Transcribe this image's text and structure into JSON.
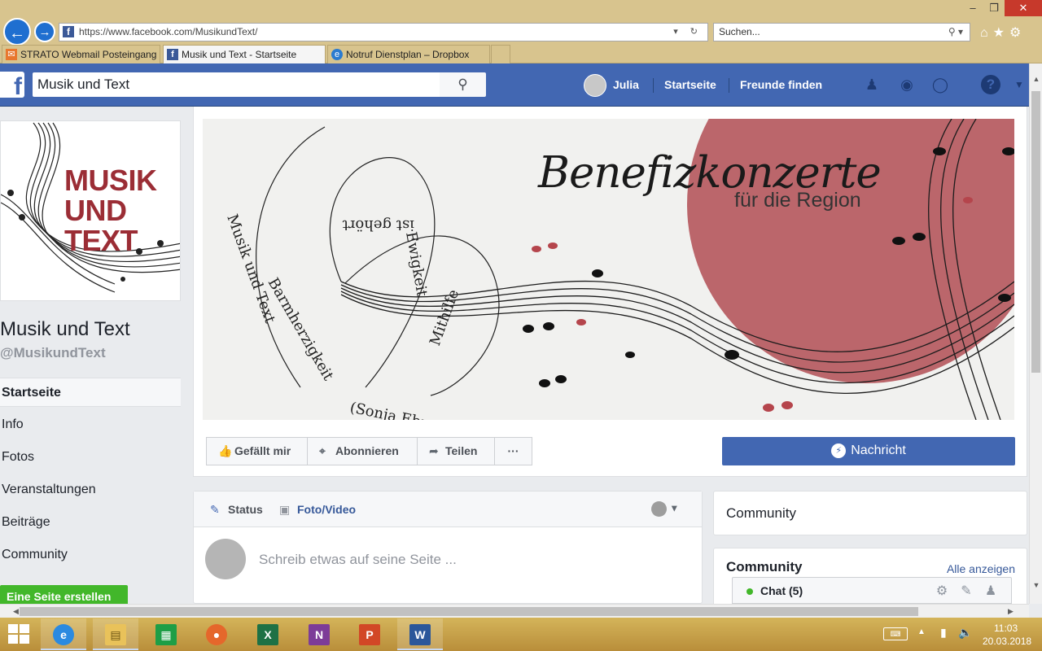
{
  "browser": {
    "url": "https://www.facebook.com/MusikundText/",
    "search_placeholder": "Suchen...",
    "tabs": [
      {
        "label": "STRATO Webmail Posteingang"
      },
      {
        "label": "Musik und Text - Startseite"
      },
      {
        "label": "Notruf Dienstplan – Dropbox"
      }
    ]
  },
  "fb_header": {
    "search_value": "Musik und Text",
    "user_name": "Julia",
    "home_link": "Startseite",
    "find_friends_link": "Freunde finden"
  },
  "page": {
    "logo_lines": [
      "MUSIK",
      "UND",
      "TEXT"
    ],
    "name": "Musik und Text",
    "handle": "@MusikundText",
    "nav": [
      "Startseite",
      "Info",
      "Fotos",
      "Veranstaltungen",
      "Beiträge",
      "Community"
    ],
    "create_page_button": "Eine Seite erstellen"
  },
  "cover": {
    "title": "Benefizkonzerte",
    "subtitle": "für die Region",
    "accent_color": "#b5565c"
  },
  "actions": {
    "like": "Gefällt mir",
    "follow": "Abonnieren",
    "share": "Teilen",
    "more": "···",
    "message": "Nachricht"
  },
  "composer": {
    "status_tab": "Status",
    "photo_tab": "Foto/Video",
    "placeholder": "Schreib etwas auf seine Seite ..."
  },
  "right": {
    "community_header": "Community",
    "community_title": "Community",
    "show_all": "Alle anzeigen"
  },
  "chat": {
    "label": "Chat (5)"
  },
  "taskbar": {
    "time": "11:03",
    "date": "20.03.2018"
  },
  "colors": {
    "fb_blue": "#4267b2",
    "green": "#42b72a",
    "chrome": "#d8c48e"
  }
}
